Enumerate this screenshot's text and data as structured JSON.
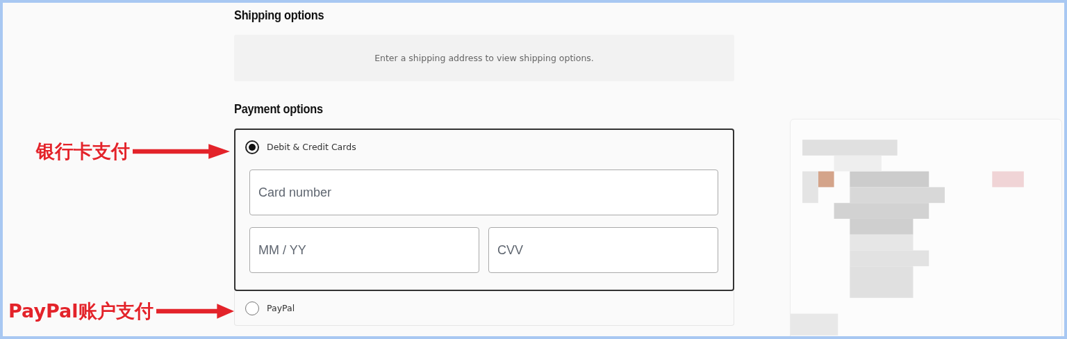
{
  "shipping": {
    "heading": "Shipping options",
    "message": "Enter a shipping address to view shipping options."
  },
  "payment": {
    "heading": "Payment options",
    "options": [
      {
        "label": "Debit & Credit Cards",
        "selected": true,
        "fields": [
          {
            "placeholder": "Card number"
          },
          {
            "placeholder": "MM / YY"
          },
          {
            "placeholder": "CVV"
          }
        ]
      },
      {
        "label": "PayPal",
        "selected": false
      }
    ]
  },
  "annotations": [
    {
      "text": "银行卡支付"
    },
    {
      "text": "PayPal账户支付"
    }
  ]
}
